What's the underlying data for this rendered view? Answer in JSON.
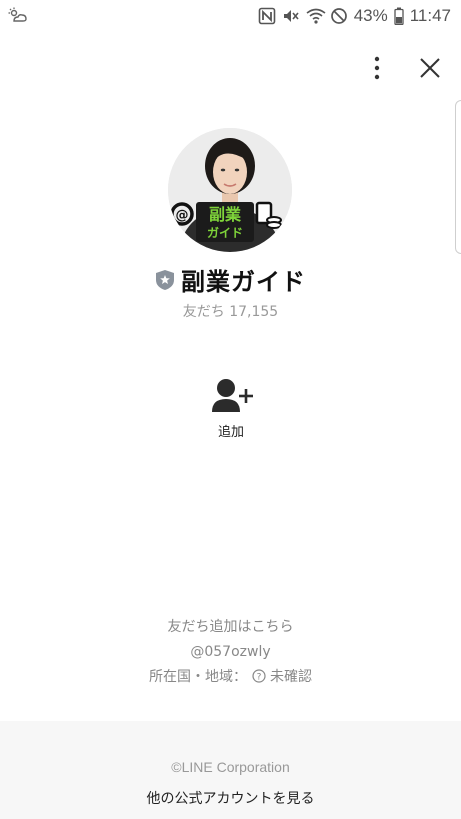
{
  "status_bar": {
    "battery_percent": "43%",
    "time": "11:47",
    "icons": [
      "weather-icon",
      "nfc-icon",
      "mute-icon",
      "wifi-icon",
      "do-not-disturb-icon",
      "battery-icon"
    ]
  },
  "top_bar": {
    "more_icon": "more-vertical-icon",
    "close_icon": "close-icon"
  },
  "profile": {
    "avatar_logo_text": "副業",
    "avatar_logo_subtext": "ガイド",
    "name": "副業ガイド",
    "friends_count": "友だち 17,155",
    "badge_icon": "shield-star-icon"
  },
  "actions": {
    "add_label": "追加",
    "add_icon": "add-friend-icon"
  },
  "info": {
    "add_friend_prompt": "友だち追加はこちら",
    "line_id": "@057ozwly",
    "region_label": "所在国・地域：",
    "region_value": "未確認"
  },
  "footer": {
    "copyright": "©LINE Corporation",
    "other_accounts_link": "他の公式アカウントを見る"
  },
  "colors": {
    "accent": "#7fd43a",
    "text": "#222222",
    "muted": "#999999",
    "footer_bg": "#f7f7f7"
  }
}
